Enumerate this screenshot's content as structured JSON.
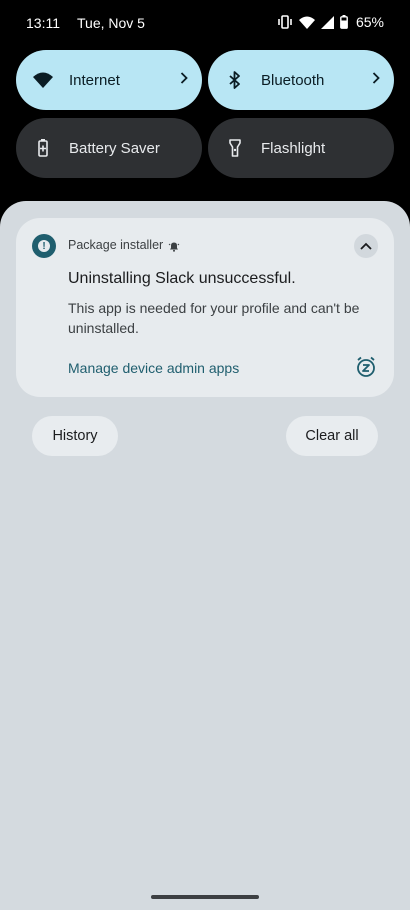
{
  "status": {
    "time": "13:11",
    "date": "Tue, Nov 5",
    "battery": "65%"
  },
  "tiles": [
    {
      "label": "Internet",
      "state": "on",
      "icon": "wifi-icon"
    },
    {
      "label": "Bluetooth",
      "state": "on",
      "icon": "bluetooth-icon"
    },
    {
      "label": "Battery Saver",
      "state": "off",
      "icon": "battery-saver-icon"
    },
    {
      "label": "Flashlight",
      "state": "off",
      "icon": "flashlight-icon"
    }
  ],
  "notification": {
    "app": "Package installer",
    "title": "Uninstalling Slack unsuccessful.",
    "body": "This app is needed for your profile and can't be uninstalled.",
    "action": "Manage device admin apps"
  },
  "buttons": {
    "history": "History",
    "clear_all": "Clear all"
  },
  "colors": {
    "tile_on": "#b8e6f4",
    "tile_off": "#2e3033",
    "shade": "#d4dadf",
    "accent": "#1f5e6e"
  }
}
